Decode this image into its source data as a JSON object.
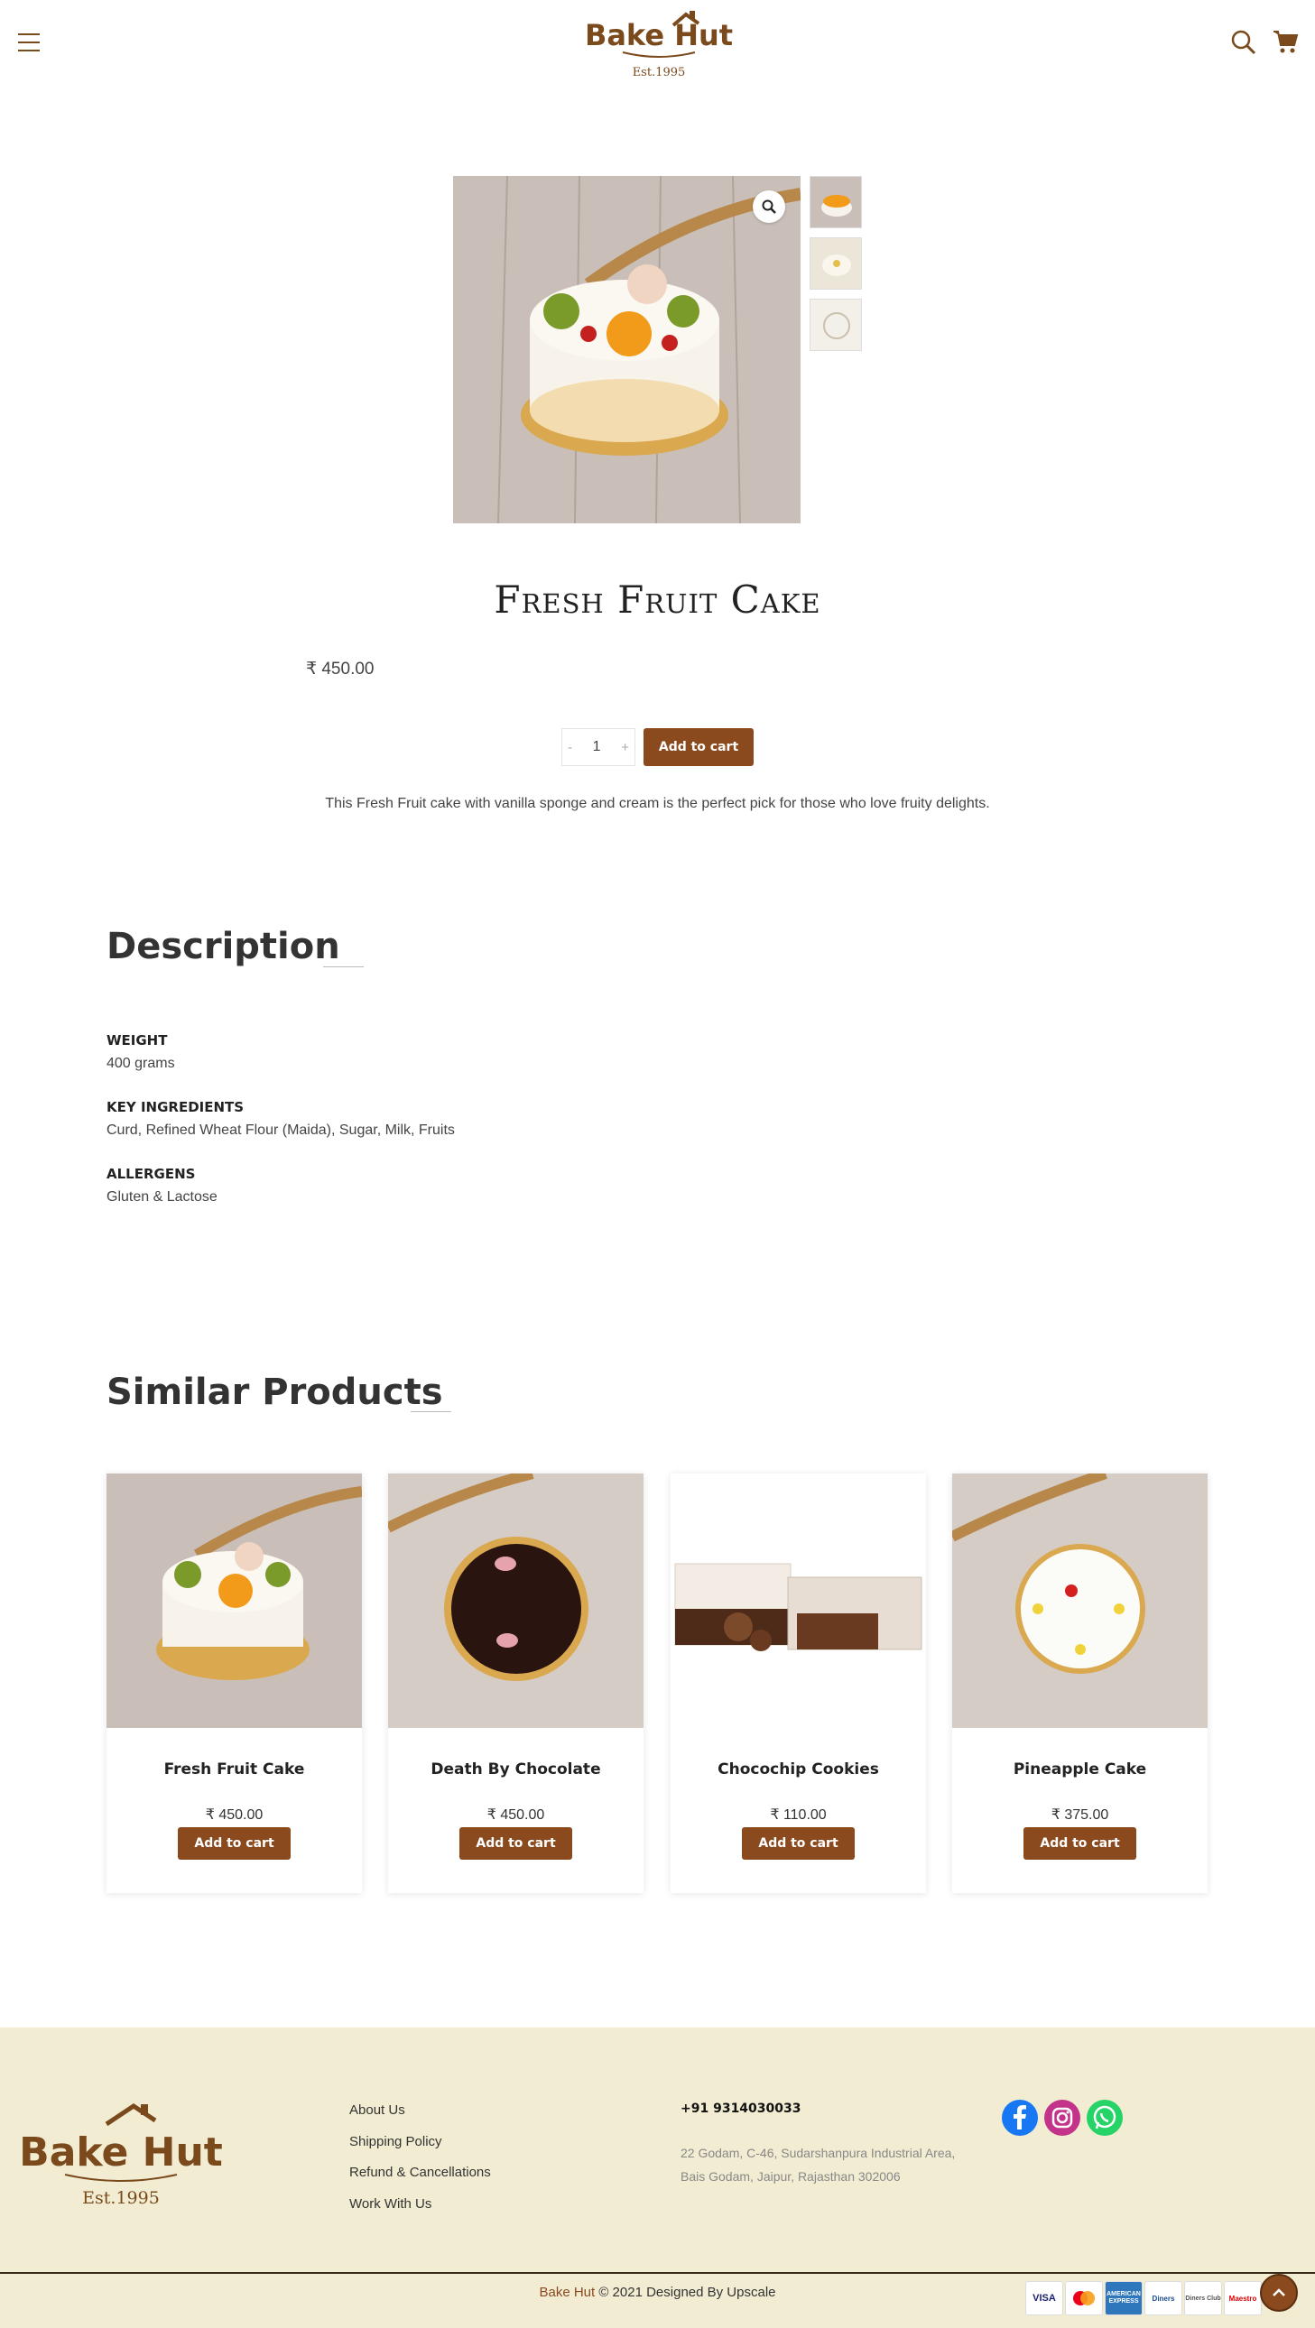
{
  "header": {
    "logo_text": "Bake Hut",
    "logo_tagline": "Est.1995",
    "menu_icon": "hamburger-icon",
    "search_icon": "search-icon",
    "cart_icon": "cart-icon"
  },
  "product": {
    "title": "Fresh Fruit Cake",
    "price": "₹ 450.00",
    "quantity": "1",
    "qty_minus": "-",
    "qty_plus": "+",
    "add_to_cart": "Add to cart",
    "short_description": "This Fresh Fruit cake with vanilla sponge and cream is the perfect pick for those who love fruity delights."
  },
  "description": {
    "heading": "Description",
    "specs": [
      {
        "label": "WEIGHT",
        "value": "400 grams"
      },
      {
        "label": "KEY INGREDIENTS",
        "value": "Curd, Refined Wheat Flour (Maida), Sugar, Milk, Fruits"
      },
      {
        "label": "ALLERGENS",
        "value": "Gluten & Lactose"
      }
    ]
  },
  "similar": {
    "heading": "Similar Products",
    "products": [
      {
        "name": "Fresh Fruit Cake",
        "price": "₹ 450.00",
        "button": "Add to cart"
      },
      {
        "name": "Death By Chocolate",
        "price": "₹ 450.00",
        "button": "Add to cart"
      },
      {
        "name": "Chocochip Cookies",
        "price": "₹ 110.00",
        "button": "Add to cart"
      },
      {
        "name": "Pineapple Cake",
        "price": "₹ 375.00",
        "button": "Add to cart"
      }
    ]
  },
  "footer": {
    "logo_text": "Bake Hut",
    "logo_tagline": "Est.1995",
    "links": [
      "About Us",
      "Shipping Policy",
      "Refund & Cancellations",
      "Work With Us"
    ],
    "phone": "+91 9314030033",
    "address_line1": "22 Godam, C-46, Sudarshanpura Industrial Area,",
    "address_line2": "Bais Godam, Jaipur, Rajasthan 302006",
    "social": [
      "facebook-icon",
      "instagram-icon",
      "whatsapp-icon"
    ],
    "copyright_brand": "Bake Hut",
    "copyright_rest": " © 2021 Designed By Upscale",
    "payments": [
      "VISA",
      "Mastercard",
      "AMERICAN EXPRESS",
      "Diners",
      "Diners Club",
      "Maestro"
    ]
  },
  "colors": {
    "brand": "#8b4a1e",
    "footer_bg": "#f2ecd2"
  }
}
